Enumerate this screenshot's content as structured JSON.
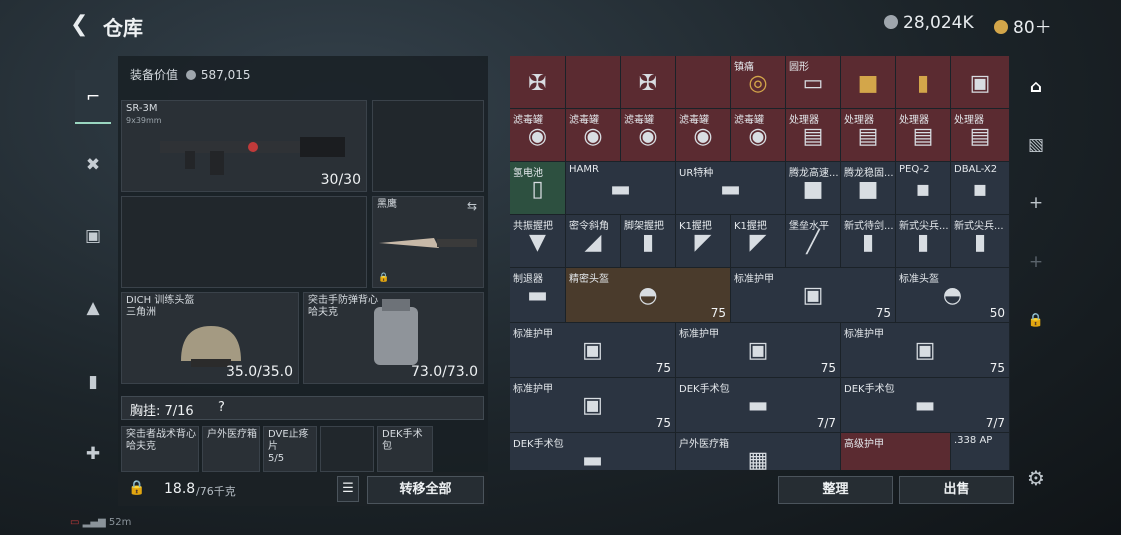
{
  "header": {
    "back_icon": "back-arrow-icon",
    "title": "仓库",
    "currency1": "28,024K",
    "currency2": "80＋",
    "colors": {
      "silver": "#9fa6ad",
      "gold": "#d3a64a"
    }
  },
  "sidebar": {
    "items": [
      {
        "icon": "pistol-icon"
      },
      {
        "icon": "vest-icon"
      },
      {
        "icon": "backpack-icon"
      },
      {
        "icon": "bag-icon"
      },
      {
        "icon": "case-icon"
      },
      {
        "icon": "medkit-icon"
      }
    ]
  },
  "loadout": {
    "value_label": "装备价值",
    "value": "587,015",
    "primary": {
      "name": "SR-3M",
      "caliber": "9x39mm",
      "ammo": "30/30"
    },
    "melee": {
      "name": "黑鹰"
    },
    "helmet": {
      "name": "DICH 训练头盔",
      "map": "三角洲",
      "durability": "35.0/35.0"
    },
    "armor": {
      "name": "突击手防弹背心",
      "map": "哈夫克",
      "durability": "73.0/73.0"
    },
    "chest_rig": {
      "label": "胸挂: 7/16",
      "help": "?"
    },
    "rig_items": [
      {
        "name": "突击者战术背心",
        "sub": "哈夫克"
      },
      {
        "name": "户外医疗箱"
      },
      {
        "name": "DVE止疼片",
        "sub": "5/5"
      },
      {
        "name": ""
      },
      {
        "name": "DEK手术包"
      }
    ],
    "weight": "18.8",
    "weight_max": "/76千克",
    "transfer_all": "转移全部"
  },
  "storage": {
    "rows": [
      [
        {
          "l": ""
        },
        {
          "l": ""
        },
        {
          "l": ""
        },
        {
          "l": "镇痛"
        },
        {
          "l": "圆形"
        },
        {
          "l": ""
        },
        {
          "l": ""
        },
        {
          "l": ""
        }
      ],
      [
        {
          "l": "滤毒罐"
        },
        {
          "l": "滤毒罐"
        },
        {
          "l": "滤毒罐"
        },
        {
          "l": "滤毒罐"
        },
        {
          "l": "滤毒罐"
        },
        {
          "l": "处理器"
        },
        {
          "l": "处理器"
        },
        {
          "l": "处理器"
        },
        {
          "l": "处理器"
        }
      ],
      [
        {
          "l": "氢电池"
        },
        {
          "l": "HAMR"
        },
        {
          "l": "UR特种"
        },
        {
          "l": "腾龙高速..."
        },
        {
          "l": "腾龙稳固..."
        },
        {
          "l": "PEQ-2"
        },
        {
          "l": "DBAL-X2"
        }
      ],
      [
        {
          "l": "共振握把"
        },
        {
          "l": "密令斜角"
        },
        {
          "l": "脚架握把"
        },
        {
          "l": "K1握把"
        },
        {
          "l": "K1握把"
        },
        {
          "l": "堡垒水平"
        },
        {
          "l": "新式待剑..."
        },
        {
          "l": "新式尖兵..."
        },
        {
          "l": "新式尖兵..."
        }
      ],
      [
        {
          "l": "制退器"
        },
        {
          "l": "精密头盔",
          "v": "75"
        },
        {
          "l": "标准护甲",
          "v": "75"
        },
        {
          "l": "标准头盔",
          "v": "50"
        }
      ],
      [
        {
          "l": "标准护甲",
          "v": "75"
        },
        {
          "l": "标准护甲",
          "v": "75"
        },
        {
          "l": "标准护甲",
          "v": "75"
        }
      ],
      [
        {
          "l": "标准护甲",
          "v": "75"
        },
        {
          "l": "DEK手术包",
          "v": "7/7"
        },
        {
          "l": "DEK手术包",
          "v": "7/7"
        }
      ],
      [
        {
          "l": "DEK手术包"
        },
        {
          "l": "户外医疗箱"
        },
        {
          "l": "高级护甲"
        },
        {
          "l": ".338 AP"
        }
      ]
    ],
    "sort": "整理",
    "sell": "出售"
  },
  "right_sidebar": {
    "icons": [
      "safebox-icon",
      "weapon-case-icon",
      "plus-icon",
      "plus-icon",
      "lock-icon"
    ],
    "settings": "gear-icon"
  },
  "status": {
    "battery": "52m"
  }
}
